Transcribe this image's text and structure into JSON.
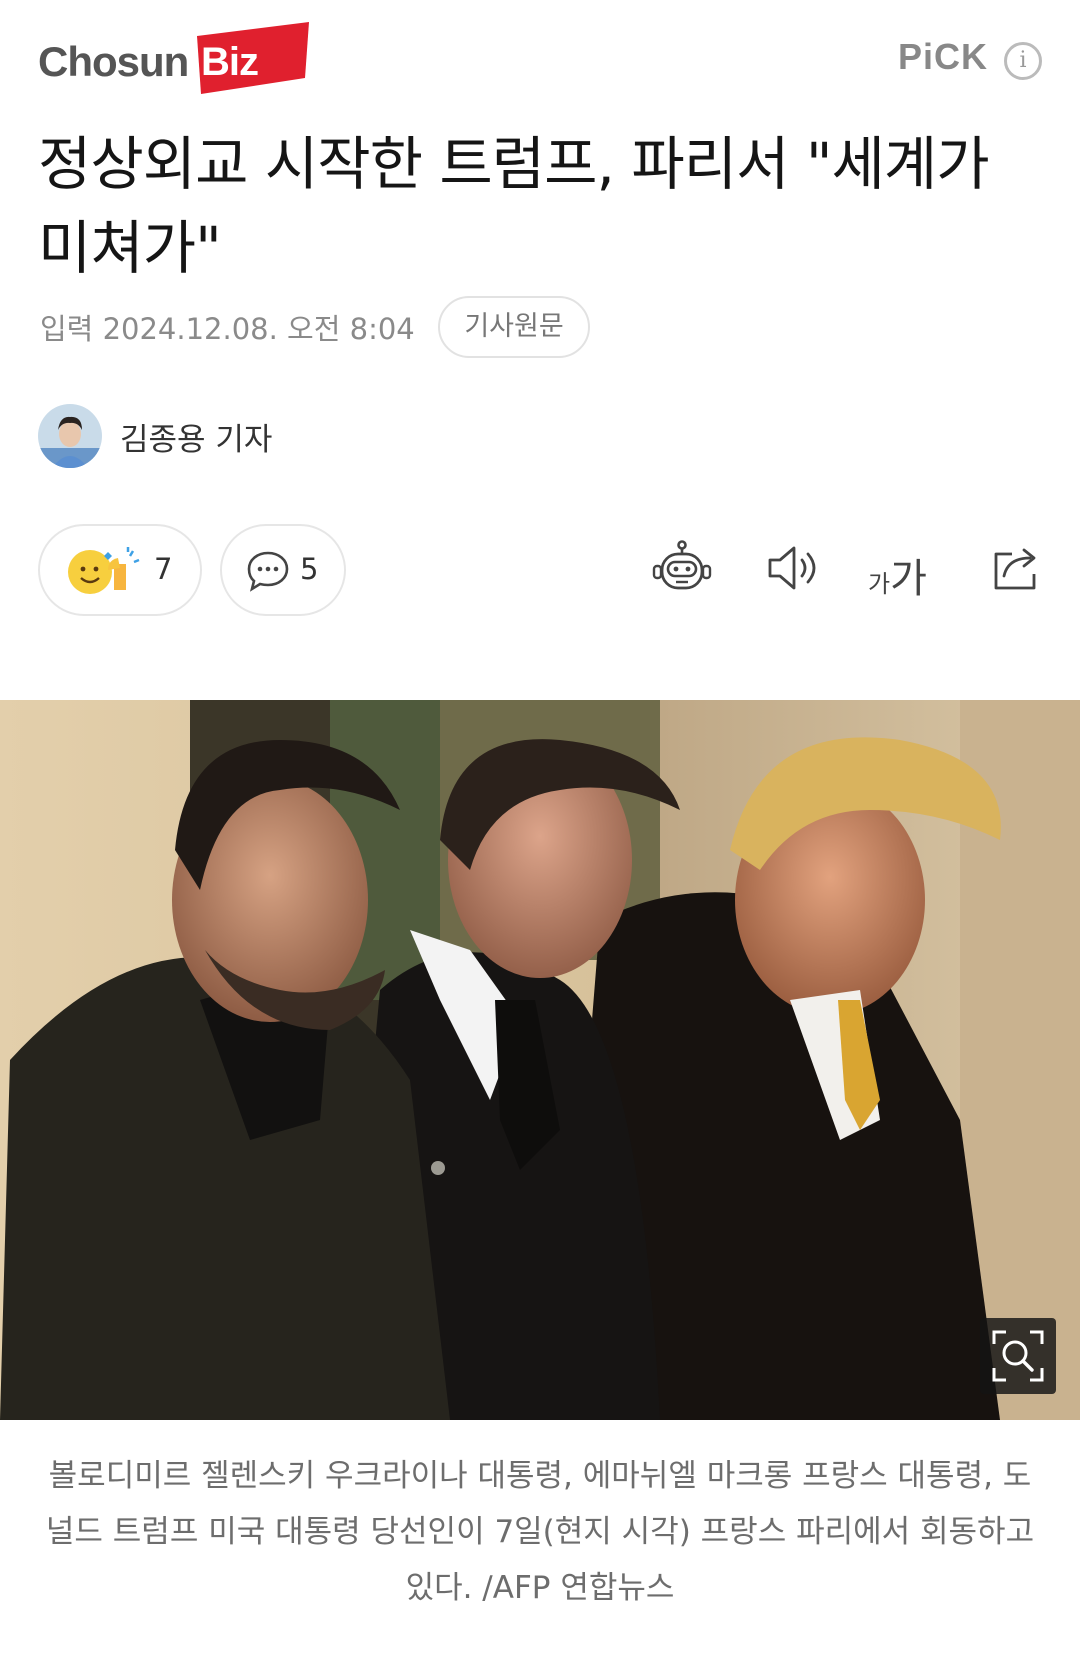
{
  "header": {
    "logo_text_main": "Chosun",
    "logo_text_accent": "Biz",
    "pick_label": "PiCK",
    "info_icon": "info-icon"
  },
  "article": {
    "headline": "정상외교 시작한 트럼프, 파리서 \"세계가 미쳐가\"",
    "date_text": "입력 2024.12.08. 오전 8:04",
    "original_button": "기사원문",
    "author": "김종용 기자"
  },
  "reactions": {
    "reaction_count": "7",
    "comment_count": "5"
  },
  "toolbar": {
    "icons": [
      "summary-bot-icon",
      "speaker-icon",
      "font-size-icon",
      "share-icon"
    ],
    "font_small": "가",
    "font_large": "가"
  },
  "photo": {
    "caption": "볼로디미르 젤렌스키 우크라이나 대통령, 에마뉘엘 마크롱 프랑스 대통령, 도널드 트럼프 미국 대통령 당선인이 7일(현지 시각) 프랑스 파리에서 회동하고 있다. /AFP 연합뉴스"
  },
  "colors": {
    "brand_red": "#e0202e",
    "muted_text": "#8a8a8a",
    "border": "#e6e6e6"
  }
}
